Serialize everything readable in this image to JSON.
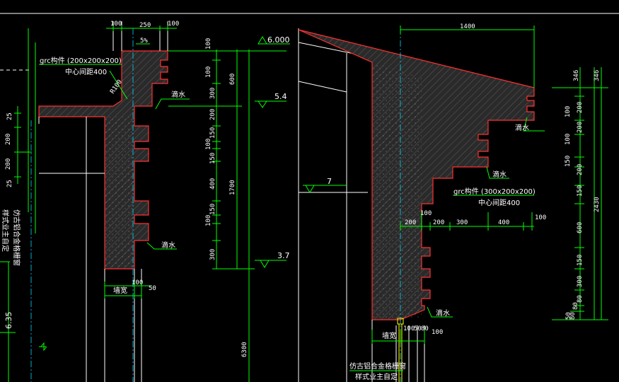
{
  "colors": {
    "background": "#000000",
    "dimension_line": "#00ff00",
    "section_outline": "#ff3030",
    "concrete_fill": "#2a2a2a",
    "centerline": "#00d8ff",
    "text": "#ffffff",
    "rebar": "#ffff00"
  },
  "left_detail": {
    "top_dims": {
      "left": "100",
      "mid": "250",
      "right": "100"
    },
    "slope": "5%",
    "grc_label": "grc构件 (200x200x200)",
    "grc_spacing": "中心间距400",
    "radius": "R100",
    "drip_1": "滴水",
    "drip_2": "滴水",
    "side_dims_inner": [
      "100",
      "100",
      "300",
      "200",
      "150",
      "100",
      "150",
      "400",
      "150",
      "100",
      "300"
    ],
    "side_dims_outer": [
      "600",
      "1700"
    ],
    "total_height": "6300",
    "bottom_label": "墙宽",
    "bottom_dim_1": "100",
    "bottom_dim_2": "50",
    "far_left_dims": [
      "25",
      "200",
      "200",
      "25"
    ],
    "far_left_note_1": "仿古铝合金格栅窗",
    "far_left_note_2": "样式业主自定",
    "far_left_elev": "6.35"
  },
  "elevations": {
    "e1": "6.000",
    "e2": "5.4",
    "e3": "3.7",
    "e4": "7"
  },
  "right_detail": {
    "top_dim": "1400",
    "drip_1": "滴水",
    "drip_2": "滴水",
    "drip_3": "滴水",
    "grc_label": "grc构件 (300x200x200)",
    "grc_spacing": "中心间距400",
    "horiz_dims": [
      "100",
      "200",
      "200",
      "300",
      "400",
      "100"
    ],
    "side_dims_inner": [
      "100",
      "200",
      "100",
      "200",
      "150",
      "600",
      "150",
      "300",
      "80",
      "80"
    ],
    "side_dims_outer": [
      "346",
      "2430",
      "50",
      "80"
    ],
    "side_top": "346",
    "bottom_label": "墙宽",
    "bottom_dims": [
      "100",
      "50",
      "80",
      "100"
    ],
    "window_note_1": "仿古铝合金格栅窗",
    "window_note_2": "样式业主自定"
  }
}
